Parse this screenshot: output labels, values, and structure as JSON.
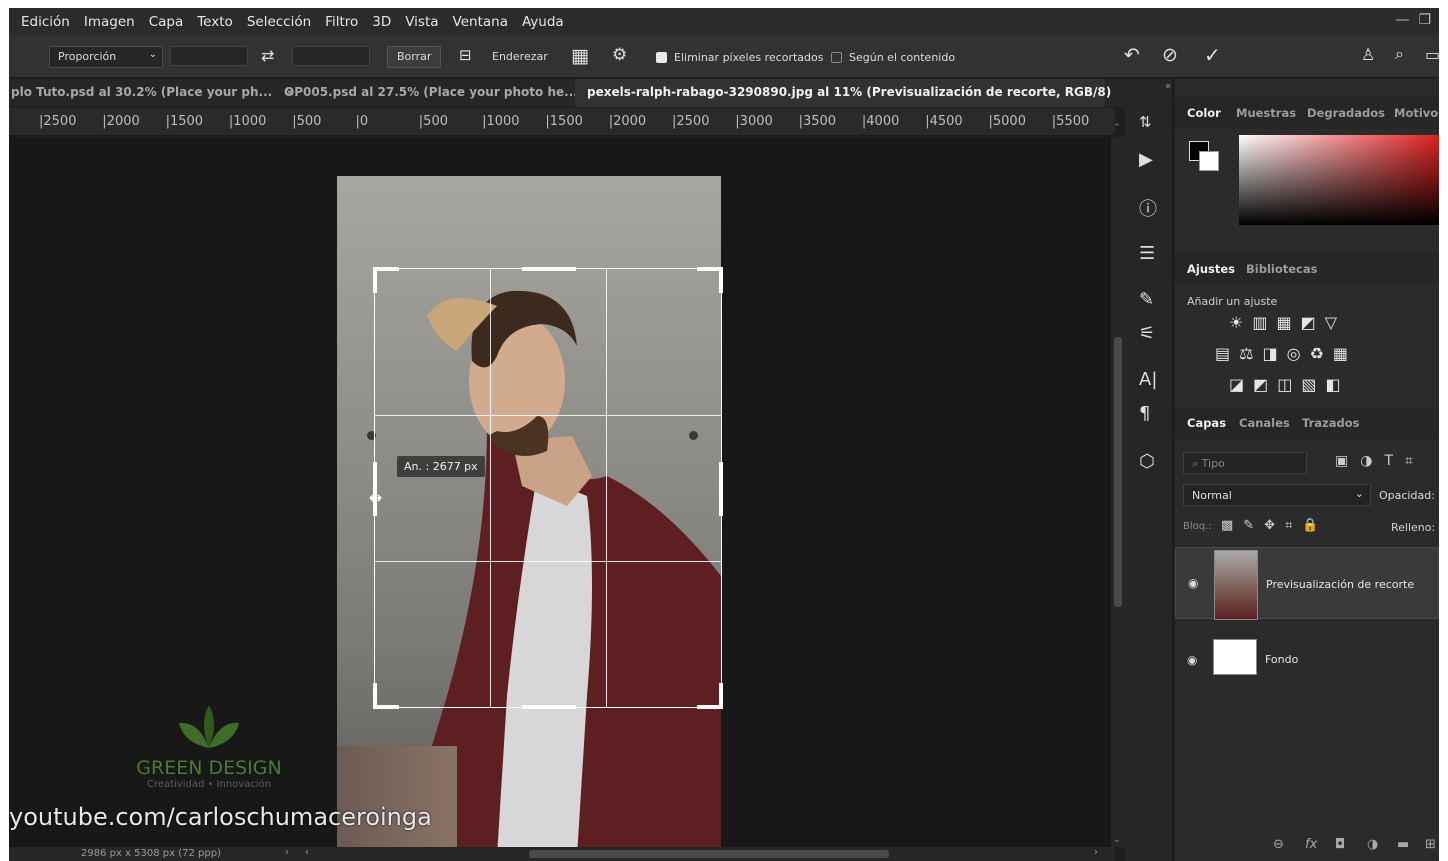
{
  "menu": [
    "Edición",
    "Imagen",
    "Capa",
    "Texto",
    "Selección",
    "Filtro",
    "3D",
    "Vista",
    "Ventana",
    "Ayuda"
  ],
  "options": {
    "ratio_select": "Proporción",
    "clear_button": "Borrar",
    "straighten_label": "Enderezar",
    "delete_pixels_label": "Eliminar píxeles recortados",
    "content_aware_label": "Según el contenido"
  },
  "tabs": [
    {
      "label": "plo Tuto.psd al 30.2% (Place your ph...",
      "active": false
    },
    {
      "label": "OP005.psd al 27.5% (Place your photo he...",
      "active": false
    },
    {
      "label": "pexels-ralph-rabago-3290890.jpg al 11% (Previsualización de recorte, RGB/8)",
      "active": true
    }
  ],
  "ruler_ticks": [
    "2500",
    "2000",
    "1500",
    "1000",
    "500",
    "0",
    "500",
    "1000",
    "1500",
    "2000",
    "2500",
    "3000",
    "3500",
    "4000",
    "4500",
    "5000",
    "5500"
  ],
  "crop_tooltip": "An. :  2677 px",
  "status_text": "2986 px x 5308 px (72 ppp)",
  "watermark": {
    "brand": "GREEN DESIGN",
    "tagline": "Creatividad • Innovación"
  },
  "youtube_overlay": "youtube.com/carloschumaceroinga",
  "panels": {
    "color_tabs": [
      "Color",
      "Muestras",
      "Degradados",
      "Motivos"
    ],
    "adjust_tabs": [
      "Ajustes",
      "Bibliotecas"
    ],
    "add_adjustment": "Añadir un ajuste",
    "layers_tabs": [
      "Capas",
      "Canales",
      "Trazados"
    ],
    "filter_placeholder": "Tipo",
    "blend_mode": "Normal",
    "opacity_label": "Opacidad:",
    "lock_label": "Bloq.:",
    "fill_label": "Relleno:",
    "layers": [
      {
        "name": "Previsualización de recorte",
        "selected": true
      },
      {
        "name": "Fondo",
        "selected": false
      }
    ]
  },
  "colors": {
    "foreground": "#000000",
    "background": "#ffffff",
    "accent_red": "#e02020"
  }
}
